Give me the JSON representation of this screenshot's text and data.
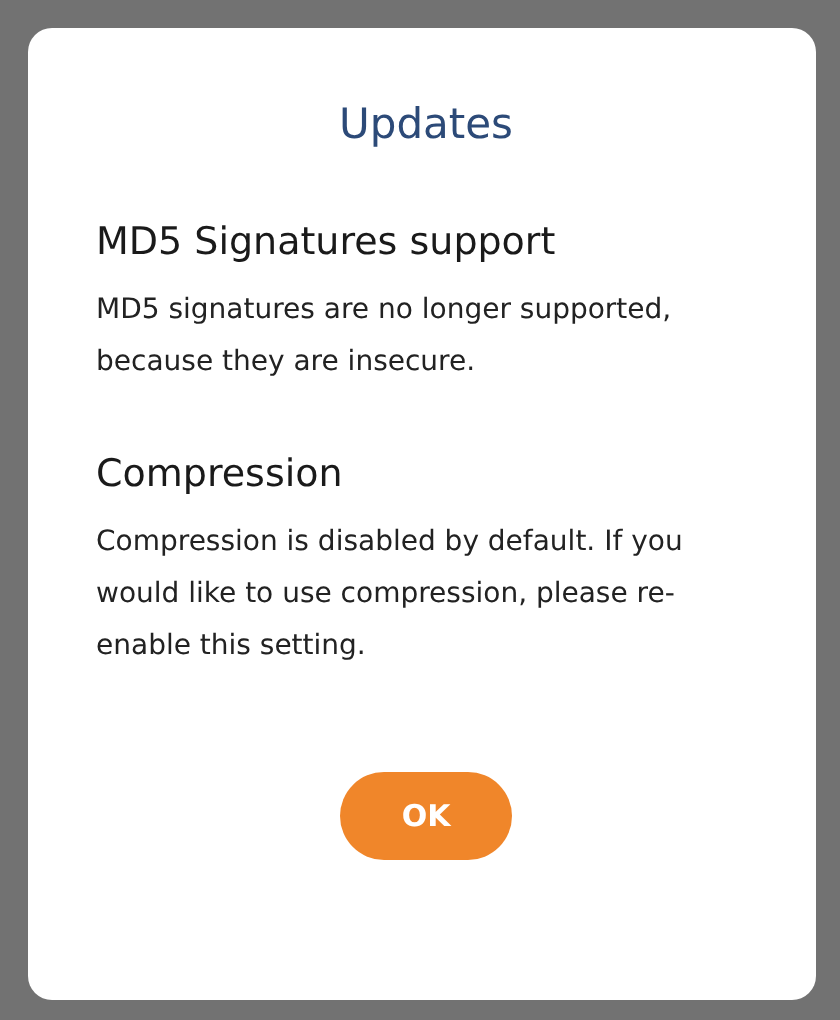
{
  "dialog": {
    "title": "Updates",
    "sections": [
      {
        "heading": "MD5 Signatures support",
        "text": "MD5 signatures are no longer supported, because they are insecure."
      },
      {
        "heading": "Compression",
        "text": "Compression is disabled by default. If you would like to use compression, please re-enable this setting."
      }
    ],
    "button": "OK"
  }
}
